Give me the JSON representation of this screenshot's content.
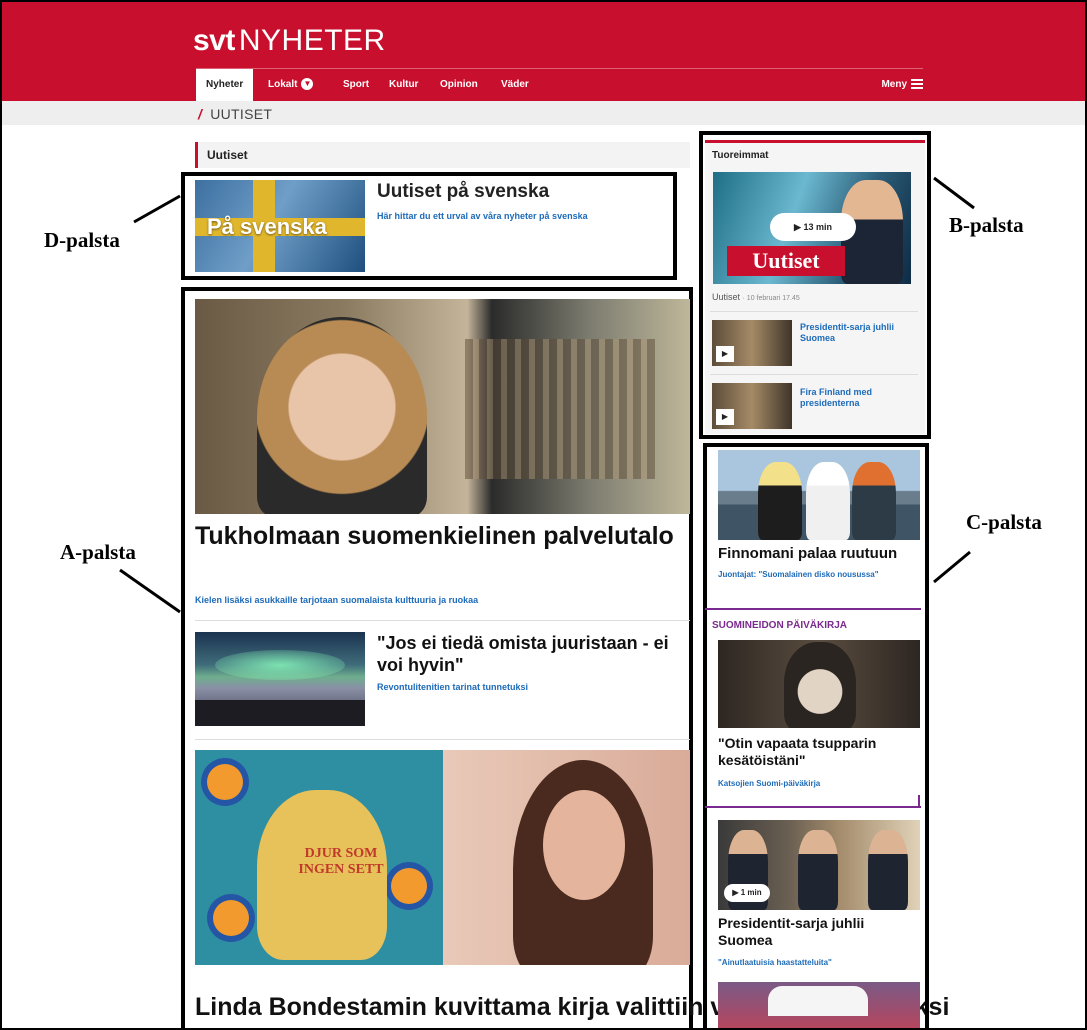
{
  "header": {
    "logo_bold": "svt",
    "logo_text": "NYHETER",
    "nav": [
      "Nyheter",
      "Lokalt",
      "Sport",
      "Kultur",
      "Opinion",
      "Väder"
    ],
    "menu_label": "Meny",
    "accent_color": "#c8102e"
  },
  "breadcrumb": {
    "slash": "/",
    "label": "UUTISET"
  },
  "section_label": "Uutiset",
  "annotations": {
    "d": "D-palsta",
    "a": "A-palsta",
    "b": "B-palsta",
    "c": "C-palsta"
  },
  "d_column": {
    "image_text": "På svenska",
    "title": "Uutiset på svenska",
    "subtitle": "Här hittar du ett urval av våra nyheter på svenska"
  },
  "a_column": {
    "story1": {
      "title": "Tukholmaan suomenkielinen palvelutalo",
      "subtitle": "Kielen lisäksi asukkaille tarjotaan suomalaista kulttuuria ja ruokaa"
    },
    "story2": {
      "title": "\"Jos ei tiedä omista juuristaan - ei voi hyvin\"",
      "subtitle": "Revontulitenitien tarinat tunnetuksi"
    },
    "story3": {
      "book_text": "DJUR SOM INGEN SETT",
      "title": "Linda Bondestamin kuvittama kirja valittiin vuoden kuvakirjaksi"
    }
  },
  "b_column": {
    "heading": "Tuoreimmat",
    "main_image_text": "Uutiset",
    "play_label": "13 min",
    "meta_source": "Uutiset",
    "meta_date": "· 10 februari 17.45",
    "items": [
      {
        "label": "Presidentit-sarja juhlii Suomea"
      },
      {
        "label": "Fira Finland med presidenterna"
      }
    ]
  },
  "c_column": {
    "story1": {
      "title": "Finnomani palaa ruutuun",
      "subtitle": "Juontajat: \"Suomalainen disko nousussa\""
    },
    "kicker": "SUOMINEIDON PÄIVÄKIRJA",
    "story2": {
      "title": "\"Otin vapaata tsupparin kesätöistäni\"",
      "subtitle": "Katsojien Suomi-päiväkirja"
    },
    "story3": {
      "play_label": "1 min",
      "title": "Presidentit-sarja juhlii Suomea",
      "subtitle": "\"Ainutlaatuisia haastatteluita\""
    }
  }
}
